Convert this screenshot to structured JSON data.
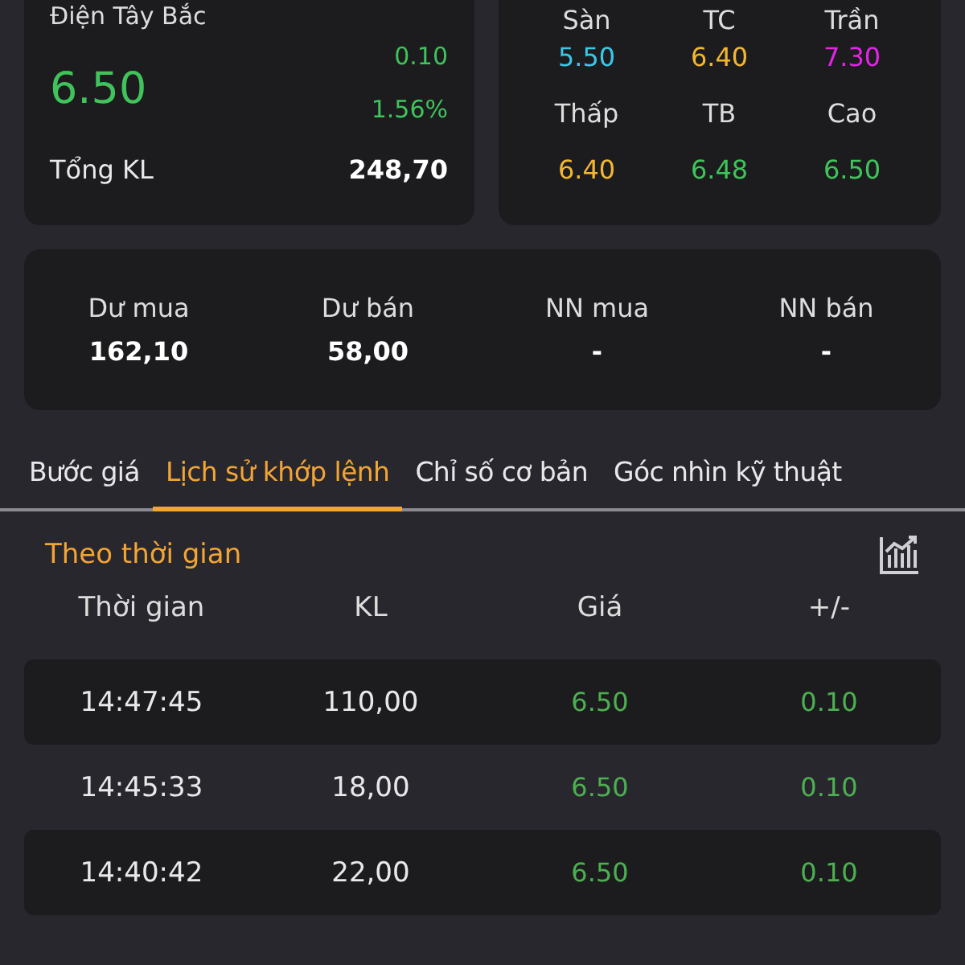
{
  "quote": {
    "name": "Điện Tây Bắc",
    "price": "6.50",
    "change": "0.10",
    "change_pct": "1.56%",
    "volume_label": "Tổng KL",
    "volume": "248,70"
  },
  "stats": [
    {
      "label": "Sàn",
      "value": "5.50",
      "color": "#3cc6e8"
    },
    {
      "label": "TC",
      "value": "6.40",
      "color": "#f2b632"
    },
    {
      "label": "Trần",
      "value": "7.30",
      "color": "#e324e6"
    },
    {
      "label": "Thấp",
      "value": "6.40",
      "color": "#f2b632"
    },
    {
      "label": "TB",
      "value": "6.48",
      "color": "#3fc35a"
    },
    {
      "label": "Cao",
      "value": "6.50",
      "color": "#3fc35a"
    }
  ],
  "book": [
    {
      "label": "Dư mua",
      "value": "162,10"
    },
    {
      "label": "Dư bán",
      "value": "58,00"
    },
    {
      "label": "NN mua",
      "value": "-"
    },
    {
      "label": "NN bán",
      "value": "-"
    }
  ],
  "tabs": [
    {
      "label": "Bước giá",
      "selected": false
    },
    {
      "label": "Lịch sử khớp lệnh",
      "selected": true
    },
    {
      "label": "Chỉ số cơ bản",
      "selected": false
    },
    {
      "label": "Góc nhìn kỹ thuật",
      "selected": false
    }
  ],
  "trades": {
    "title": "Theo thời gian",
    "columns": [
      "Thời gian",
      "KL",
      "Giá",
      "+/-"
    ],
    "rows": [
      {
        "time": "14:47:45",
        "volume": "110,00",
        "price": "6.50",
        "change": "0.10"
      },
      {
        "time": "14:45:33",
        "volume": "18,00",
        "price": "6.50",
        "change": "0.10"
      },
      {
        "time": "14:40:42",
        "volume": "22,00",
        "price": "6.50",
        "change": "0.10"
      }
    ]
  }
}
